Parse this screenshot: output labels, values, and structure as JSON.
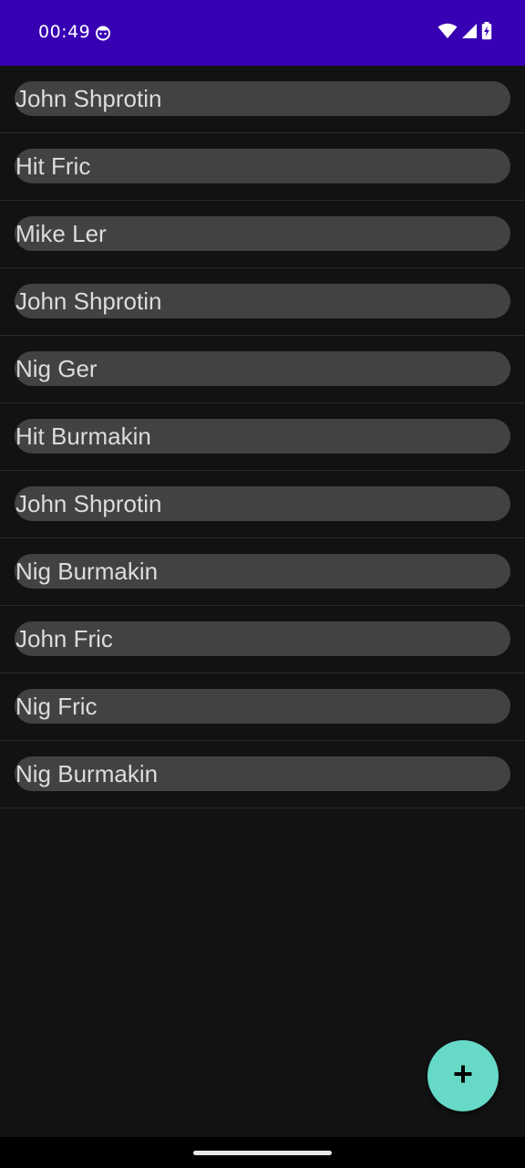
{
  "status_bar": {
    "time": "00:49",
    "background": "#3700B3",
    "icons": [
      "notification-face-icon",
      "wifi-icon",
      "cellular-signal-icon",
      "battery-charging-icon"
    ]
  },
  "list": {
    "items": [
      {
        "label": "John Shprotin"
      },
      {
        "label": "Hit Fric"
      },
      {
        "label": "Mike Ler"
      },
      {
        "label": "John Shprotin"
      },
      {
        "label": "Nig Ger"
      },
      {
        "label": "Hit Burmakin"
      },
      {
        "label": "John Shprotin"
      },
      {
        "label": "Nig Burmakin"
      },
      {
        "label": "John Fric"
      },
      {
        "label": "Nig Fric"
      },
      {
        "label": "Nig Burmakin"
      }
    ]
  },
  "fab": {
    "icon": "plus-icon",
    "color": "#66D9C7"
  },
  "colors": {
    "background": "#121212",
    "item_pill": "#424242",
    "item_text": "#dcdcdc"
  }
}
